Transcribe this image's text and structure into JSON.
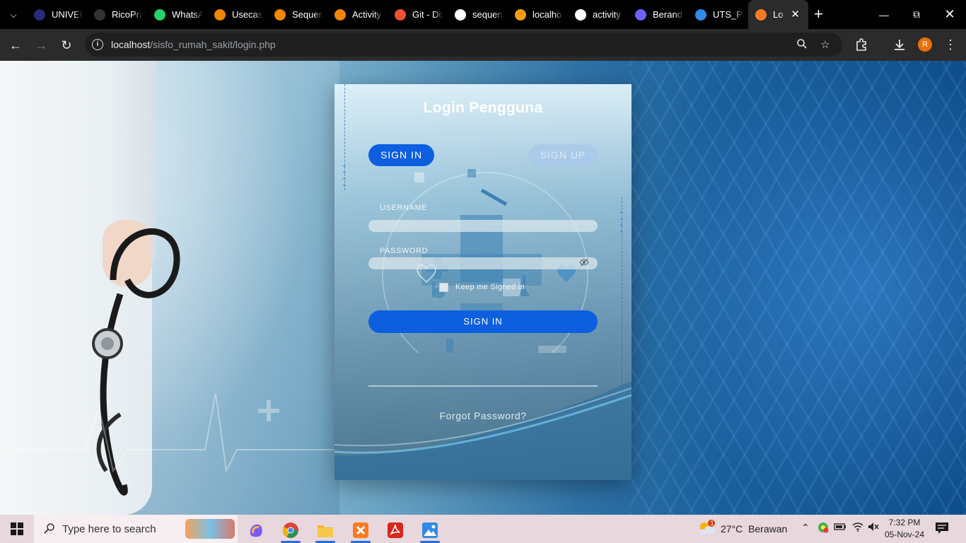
{
  "browser": {
    "tabs": [
      {
        "label": "UNIVER",
        "icon": "university-icon",
        "color": "#2a2a7a"
      },
      {
        "label": "RicoPra",
        "icon": "github-icon",
        "color": "#333333"
      },
      {
        "label": "WhatsA",
        "icon": "whatsapp-icon",
        "color": "#25d366"
      },
      {
        "label": "Usecas",
        "icon": "drawio-icon",
        "color": "#f08705"
      },
      {
        "label": "Sequen",
        "icon": "drawio-icon",
        "color": "#f08705"
      },
      {
        "label": "Activity",
        "icon": "drawio-icon",
        "color": "#f08705"
      },
      {
        "label": "Git - Do",
        "icon": "git-icon",
        "color": "#f05133"
      },
      {
        "label": "sequen",
        "icon": "google-icon",
        "color": "#ffffff"
      },
      {
        "label": "localho",
        "icon": "xampp-phpmyadmin-icon",
        "color": "#f89c0e"
      },
      {
        "label": "activity",
        "icon": "google-icon",
        "color": "#ffffff"
      },
      {
        "label": "Berand",
        "icon": "hexagon-icon",
        "color": "#6c63ff"
      },
      {
        "label": "UTS_Pe",
        "icon": "cloud-icon",
        "color": "#2f8be6"
      },
      {
        "label": "Log",
        "icon": "xampp-icon",
        "color": "#fb7a24",
        "active": true
      }
    ],
    "new_tab_label": "+",
    "url_host": "localhost",
    "url_path": "/sisfo_rumah_sakit/login.php"
  },
  "login": {
    "title": "Login Pengguna",
    "tab_signin": "SIGN IN",
    "tab_signup": "SIGN UP",
    "username_label": "USERNAME",
    "username_value": "",
    "password_label": "PASSWORD",
    "password_value": "",
    "keep_signed_in": "Keep me Signed in",
    "keep_signed_in_checked": false,
    "submit_label": "SIGN IN",
    "forgot_password": "Forgot Password?",
    "accent_color": "#0d5fe0"
  },
  "taskbar": {
    "search_placeholder": "Type here to search",
    "weather_badge": "1",
    "weather_temp": "27°C",
    "weather_desc": "Berawan",
    "time": "7:32 PM",
    "date": "05-Nov-24"
  }
}
